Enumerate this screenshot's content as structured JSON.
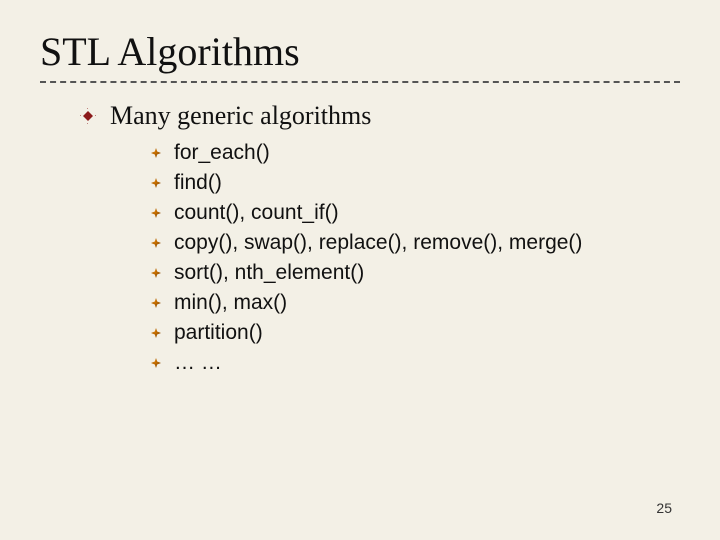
{
  "title": "STL Algorithms",
  "subtitle": "Many generic algorithms",
  "items": [
    "for_each()",
    "find()",
    "count(), count_if()",
    "copy(), swap(), replace(), remove(), merge()",
    "sort(), nth_element()",
    "min(), max()",
    "partition()",
    "… …"
  ],
  "page_number": "25"
}
